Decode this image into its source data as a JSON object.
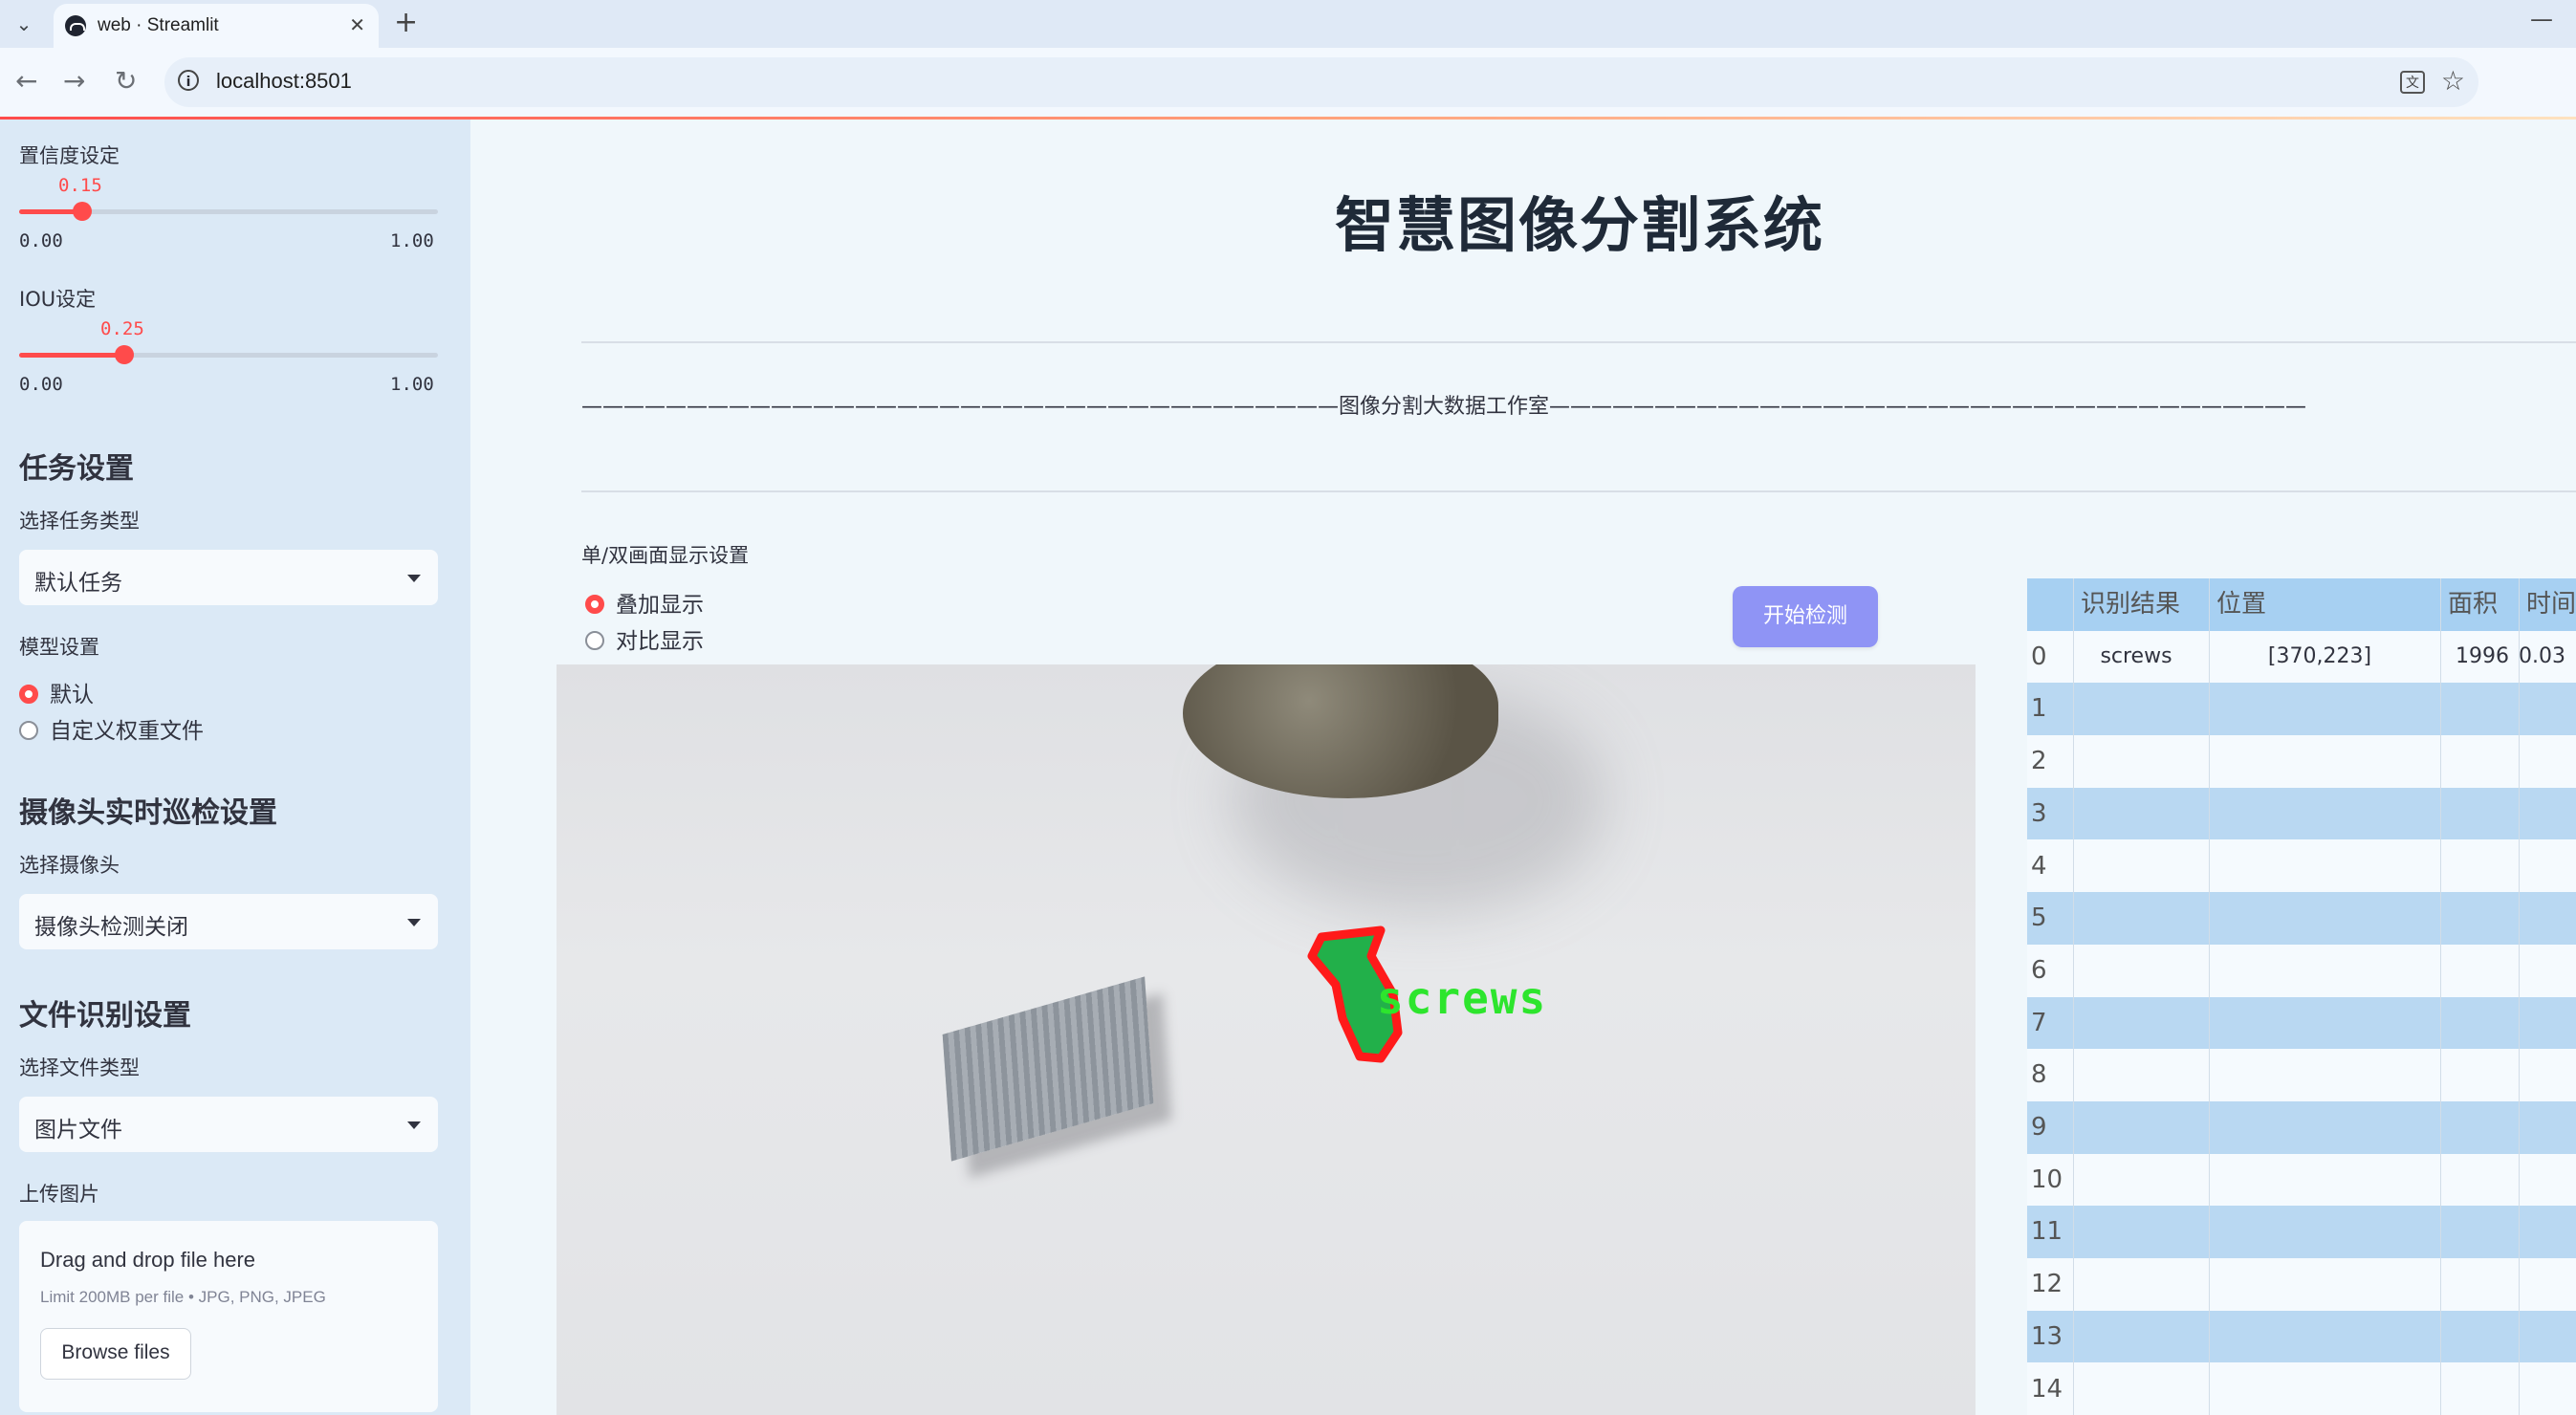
{
  "browser": {
    "tab_title": "web · Streamlit",
    "url": "localhost:8501"
  },
  "sidebar": {
    "confidence": {
      "label": "置信度设定",
      "value": "0.15",
      "min": "0.00",
      "max": "1.00",
      "fraction": 0.15
    },
    "iou": {
      "label": "IOU设定",
      "value": "0.25",
      "min": "0.00",
      "max": "1.00",
      "fraction": 0.25
    },
    "task_heading": "任务设置",
    "task_type_label": "选择任务类型",
    "task_type_value": "默认任务",
    "model_label": "模型设置",
    "model_options": [
      "默认",
      "自定义权重文件"
    ],
    "model_selected": 0,
    "camera_heading": "摄像头实时巡检设置",
    "camera_label": "选择摄像头",
    "camera_value": "摄像头检测关闭",
    "file_heading": "文件识别设置",
    "file_type_label": "选择文件类型",
    "file_type_value": "图片文件",
    "upload_label": "上传图片",
    "upload_title": "Drag and drop file here",
    "upload_limit": "Limit 200MB per file • JPG, PNG, JPEG",
    "browse_label": "Browse files"
  },
  "main": {
    "title": "智慧图像分割系统",
    "banner": "————————————————————————————————————图像分割大数据工作室————————————————————————————————————",
    "display_label": "单/双画面显示设置",
    "display_options": [
      "叠加显示",
      "对比显示"
    ],
    "display_selected": 0,
    "start_button": "开始检测",
    "detection_label": "screws",
    "table": {
      "columns": [
        "识别结果",
        "位置",
        "面积",
        "时间"
      ],
      "rows": [
        {
          "idx": "0",
          "cells": [
            "screws",
            "[370,223]",
            "1996",
            "0.03"
          ]
        },
        {
          "idx": "1",
          "cells": [
            "",
            "",
            "",
            ""
          ]
        },
        {
          "idx": "2",
          "cells": [
            "",
            "",
            "",
            ""
          ]
        },
        {
          "idx": "3",
          "cells": [
            "",
            "",
            "",
            ""
          ]
        },
        {
          "idx": "4",
          "cells": [
            "",
            "",
            "",
            ""
          ]
        },
        {
          "idx": "5",
          "cells": [
            "",
            "",
            "",
            ""
          ]
        },
        {
          "idx": "6",
          "cells": [
            "",
            "",
            "",
            ""
          ]
        },
        {
          "idx": "7",
          "cells": [
            "",
            "",
            "",
            ""
          ]
        },
        {
          "idx": "8",
          "cells": [
            "",
            "",
            "",
            ""
          ]
        },
        {
          "idx": "9",
          "cells": [
            "",
            "",
            "",
            ""
          ]
        },
        {
          "idx": "10",
          "cells": [
            "",
            "",
            "",
            ""
          ]
        },
        {
          "idx": "11",
          "cells": [
            "",
            "",
            "",
            ""
          ]
        },
        {
          "idx": "12",
          "cells": [
            "",
            "",
            "",
            ""
          ]
        },
        {
          "idx": "13",
          "cells": [
            "",
            "",
            "",
            ""
          ]
        },
        {
          "idx": "14",
          "cells": [
            "",
            "",
            "",
            ""
          ]
        }
      ]
    }
  },
  "colors": {
    "accent": "#ff4b4b",
    "button": "#8f94f5",
    "detection_outline": "#ff1a1a",
    "detection_text": "#2de52d"
  }
}
